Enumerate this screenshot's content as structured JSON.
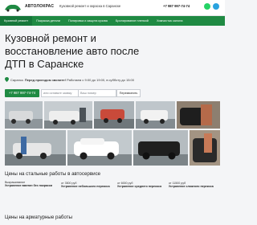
{
  "header": {
    "logo_text": "АВТОЛОКРАС",
    "tagline": "Кузовной ремонт и окраска в Саранске",
    "phone": "+7 987 997-74-74",
    "messengers": [
      "whatsapp-icon",
      "telegram-icon"
    ]
  },
  "nav": {
    "items": [
      "Кузовной ремонт",
      "Покраска детали",
      "Полировка и защита кузова",
      "Бронирование пленкой",
      "Химчистка салона"
    ]
  },
  "hero": {
    "title": "Кузовной ремонт и восстановление авто после ДТП в Саранске",
    "address": "Саранск",
    "address_note": "Перед приездом звоните!",
    "hours": "Работаем с 9:00 до 19:00, в субботу до 15:00",
    "phone_button": "+7 987 997-74-74",
    "name_placeholder": "или оставьте заявку",
    "phone_placeholder": "Ваш номер",
    "submit_label": "Перезвонить"
  },
  "sections": {
    "steel_prices_title": "Цены на стальные работы в автосервисе",
    "armature_prices_title": "Цены на арматурные работы"
  },
  "prices": [
    {
      "label": "Выкрашивание",
      "value": "",
      "desc": "Устранение вмятин без покраски"
    },
    {
      "label": "",
      "value": "от 3500 руб",
      "desc": "Устранение небольшого перекоса"
    },
    {
      "label": "",
      "value": "от 6000 руб",
      "desc": "Устранение среднего перекоса"
    },
    {
      "label": "",
      "value": "от 11500 руб",
      "desc": "Устранение сложного перекоса"
    }
  ],
  "colors": {
    "accent": "#1f8a43",
    "background": "#f4f5f7"
  }
}
